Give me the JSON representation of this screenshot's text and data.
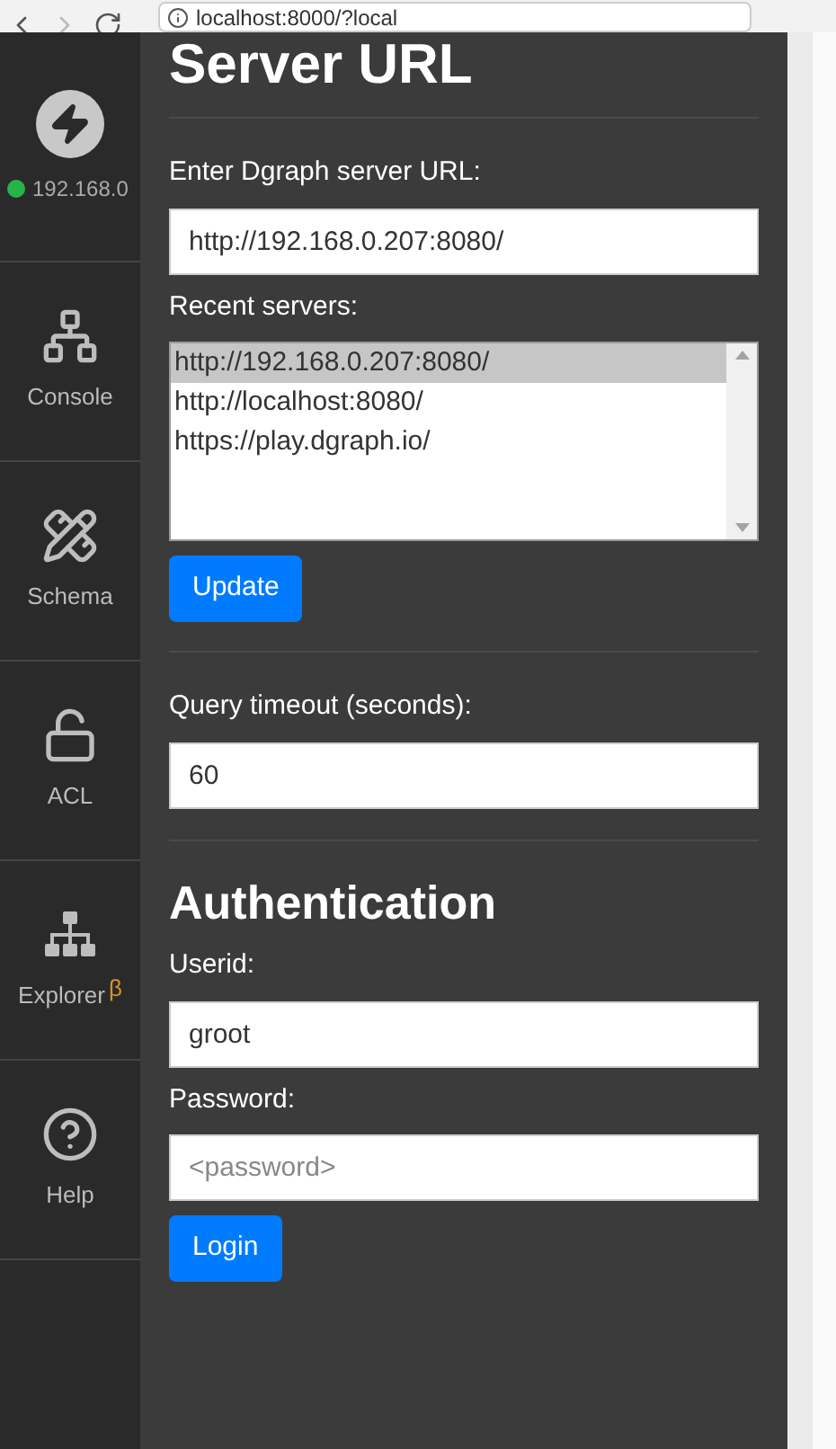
{
  "browser": {
    "url": "localhost:8000/?local"
  },
  "sidebar": {
    "server": "192.168.0",
    "connected": true,
    "items": [
      {
        "kind": "console",
        "label": "Console"
      },
      {
        "kind": "schema",
        "label": "Schema"
      },
      {
        "kind": "acl",
        "label": "ACL"
      },
      {
        "kind": "explorer",
        "label": "Explorer",
        "badge": "β"
      },
      {
        "kind": "help",
        "label": "Help"
      }
    ]
  },
  "server": {
    "title": "Server URL",
    "url_label": "Enter Dgraph server URL:",
    "url_value": "http://192.168.0.207:8080/",
    "recent_label": "Recent servers:",
    "recent": [
      {
        "label": "http://192.168.0.207:8080/",
        "selected": true
      },
      {
        "label": "http://localhost:8080/",
        "selected": false
      },
      {
        "label": "https://play.dgraph.io/",
        "selected": false
      }
    ],
    "update_button": "Update",
    "timeout_label": "Query timeout (seconds):",
    "timeout_value": "60"
  },
  "auth": {
    "title": "Authentication",
    "userid_label": "Userid:",
    "userid_value": "groot",
    "password_label": "Password:",
    "password_placeholder": "<password>",
    "login_button": "Login"
  }
}
